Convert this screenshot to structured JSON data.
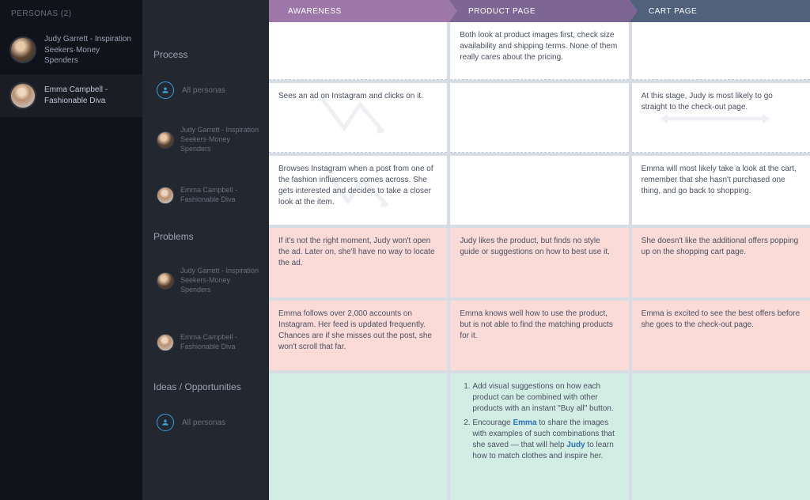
{
  "sidebar": {
    "title": "PERSONAS (2)",
    "items": [
      {
        "name": "Judy Garrett - Inspiration Seekers·Money Spenders"
      },
      {
        "name": "Emma Campbell - Fashionable Diva"
      }
    ]
  },
  "sections": {
    "process": "Process",
    "problems": "Problems",
    "ideas": "Ideas / Opportunities",
    "all_personas": "All personas",
    "judy": "Judy Garrett - Inspiration Seekers·Money Spenders",
    "emma": "Emma Campbell - Fashionable Diva"
  },
  "stages": [
    "AWARENESS",
    "PRODUCT PAGE",
    "CART PAGE"
  ],
  "process": {
    "all": {
      "awareness": "",
      "product": "Both look at product images first, check size availability and shipping terms. None of them really cares about the pricing.",
      "cart": ""
    },
    "judy": {
      "awareness": "Sees an ad on Instagram and clicks on it.",
      "product": "",
      "cart": "At this stage, Judy is most likely to go straight to the check-out page."
    },
    "emma": {
      "awareness": "Browses Instagram when a post from one of the fashion influencers comes across. She gets interested and decides to take a closer look at the item.",
      "product": "",
      "cart": "Emma will most likely take a look at the cart, remember that she hasn't purchased one thing, and go back to shopping."
    }
  },
  "problems": {
    "judy": {
      "awareness": "If it's not the right moment, Judy won't open the ad. Later on, she'll have no way to locate the ad.",
      "product": "Judy likes the product, but finds no style guide or suggestions on how to best use it.",
      "cart": "She doesn't like the additional offers popping up on the shopping cart page."
    },
    "emma": {
      "awareness": "Emma follows over 2,000 accounts on Instagram. Her feed is updated frequently. Chances are if she misses out the post, she won't scroll that far.",
      "product": "Emma knows well how to use the product, but is not able to find the matching products for it.",
      "cart": "Emma is excited to see the best offers before she goes to the check-out page."
    }
  },
  "ideas": {
    "all": {
      "awareness": "",
      "product_list": [
        "Add visual suggestions on how each product can be combined with other products with an instant \"Buy all\" button.",
        "Encourage |Emma| to share the images with examples of such combinations that she saved — that will help |Judy| to learn how to match clothes and inspire her."
      ],
      "cart": ""
    }
  }
}
